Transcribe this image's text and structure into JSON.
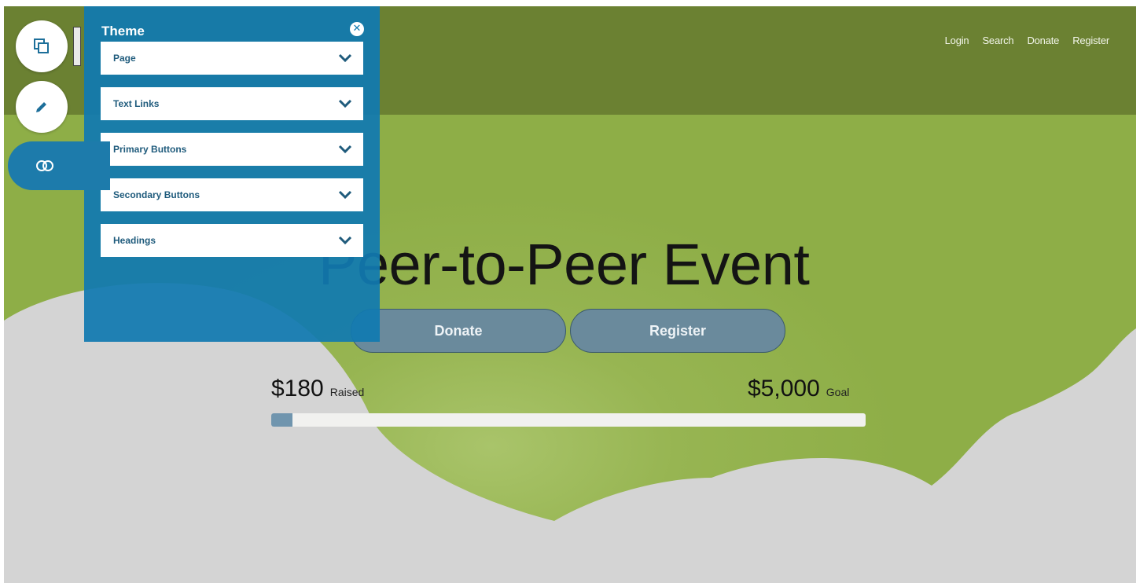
{
  "top_nav": [
    "Login",
    "Search",
    "Donate",
    "Register"
  ],
  "hero": {
    "title": "Peer-to-Peer Event",
    "donate_label": "Donate",
    "register_label": "Register"
  },
  "progress": {
    "raised_amount": "$180",
    "raised_label": "Raised",
    "goal_amount": "$5,000",
    "goal_label": "Goal",
    "fraction": 0.036
  },
  "left_rail": {
    "items": [
      {
        "icon": "copy-icon"
      },
      {
        "icon": "pencil-icon"
      },
      {
        "icon": "toggle-icon",
        "active": true
      }
    ]
  },
  "theme_panel": {
    "title": "Theme",
    "close_icon": "close-icon",
    "items": [
      {
        "label": "Page"
      },
      {
        "label": "Text Links"
      },
      {
        "label": "Primary Buttons"
      },
      {
        "label": "Secondary Buttons"
      },
      {
        "label": "Headings"
      }
    ]
  },
  "colors": {
    "header": "#6b8132",
    "hero_green": "#8eae47",
    "cloud": "#d4d4d4",
    "panel_blue": "#117ab0",
    "cta": "#6a8a9c"
  }
}
